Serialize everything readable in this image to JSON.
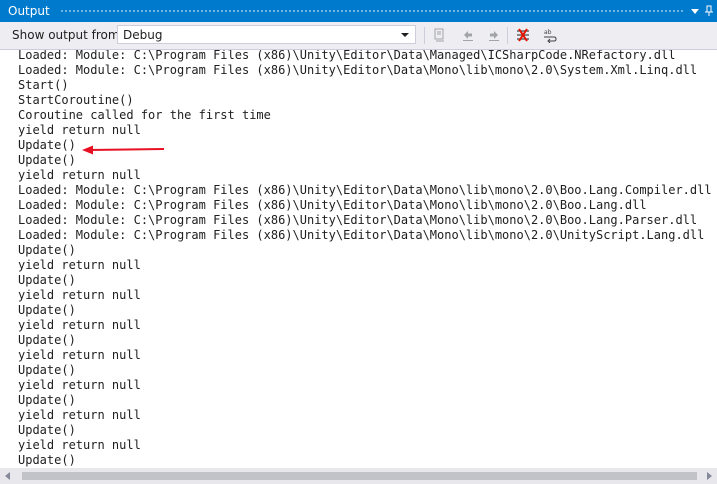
{
  "window": {
    "title": "Output"
  },
  "toolbar": {
    "show_output_label": "Show output from:",
    "source_selected": "Debug"
  },
  "output_lines": [
    "Loaded: Module: C:\\Program Files (x86)\\Unity\\Editor\\Data\\Managed\\ICSharpCode.NRefactory.dll",
    "Loaded: Module: C:\\Program Files (x86)\\Unity\\Editor\\Data\\Mono\\lib\\mono\\2.0\\System.Xml.Linq.dll",
    "Start()",
    "StartCoroutine()",
    "Coroutine called for the first time",
    "yield return null",
    "Update()",
    "Update()",
    "yield return null",
    "Loaded: Module: C:\\Program Files (x86)\\Unity\\Editor\\Data\\Mono\\lib\\mono\\2.0\\Boo.Lang.Compiler.dll",
    "Loaded: Module: C:\\Program Files (x86)\\Unity\\Editor\\Data\\Mono\\lib\\mono\\2.0\\Boo.Lang.dll",
    "Loaded: Module: C:\\Program Files (x86)\\Unity\\Editor\\Data\\Mono\\lib\\mono\\2.0\\Boo.Lang.Parser.dll",
    "Loaded: Module: C:\\Program Files (x86)\\Unity\\Editor\\Data\\Mono\\lib\\mono\\2.0\\UnityScript.Lang.dll",
    "Update()",
    "yield return null",
    "Update()",
    "yield return null",
    "Update()",
    "yield return null",
    "Update()",
    "yield return null",
    "Update()",
    "yield return null",
    "Update()",
    "yield return null",
    "Update()",
    "yield return null",
    "Update()"
  ],
  "annotation": {
    "arrow_color": "#e81123",
    "points_to_line": 6
  },
  "colors": {
    "titlebar": "#007acc",
    "toolbar_bg": "#eeeef2",
    "text": "#1e1e1e"
  },
  "icons": {
    "dock": "dropdown-pin-icon",
    "pin": "pin-icon",
    "find_message": "find-message-in-code-icon",
    "prev": "go-to-previous-message-icon",
    "next": "go-to-next-message-icon",
    "clear": "clear-all-icon",
    "wrap": "toggle-word-wrap-icon"
  }
}
